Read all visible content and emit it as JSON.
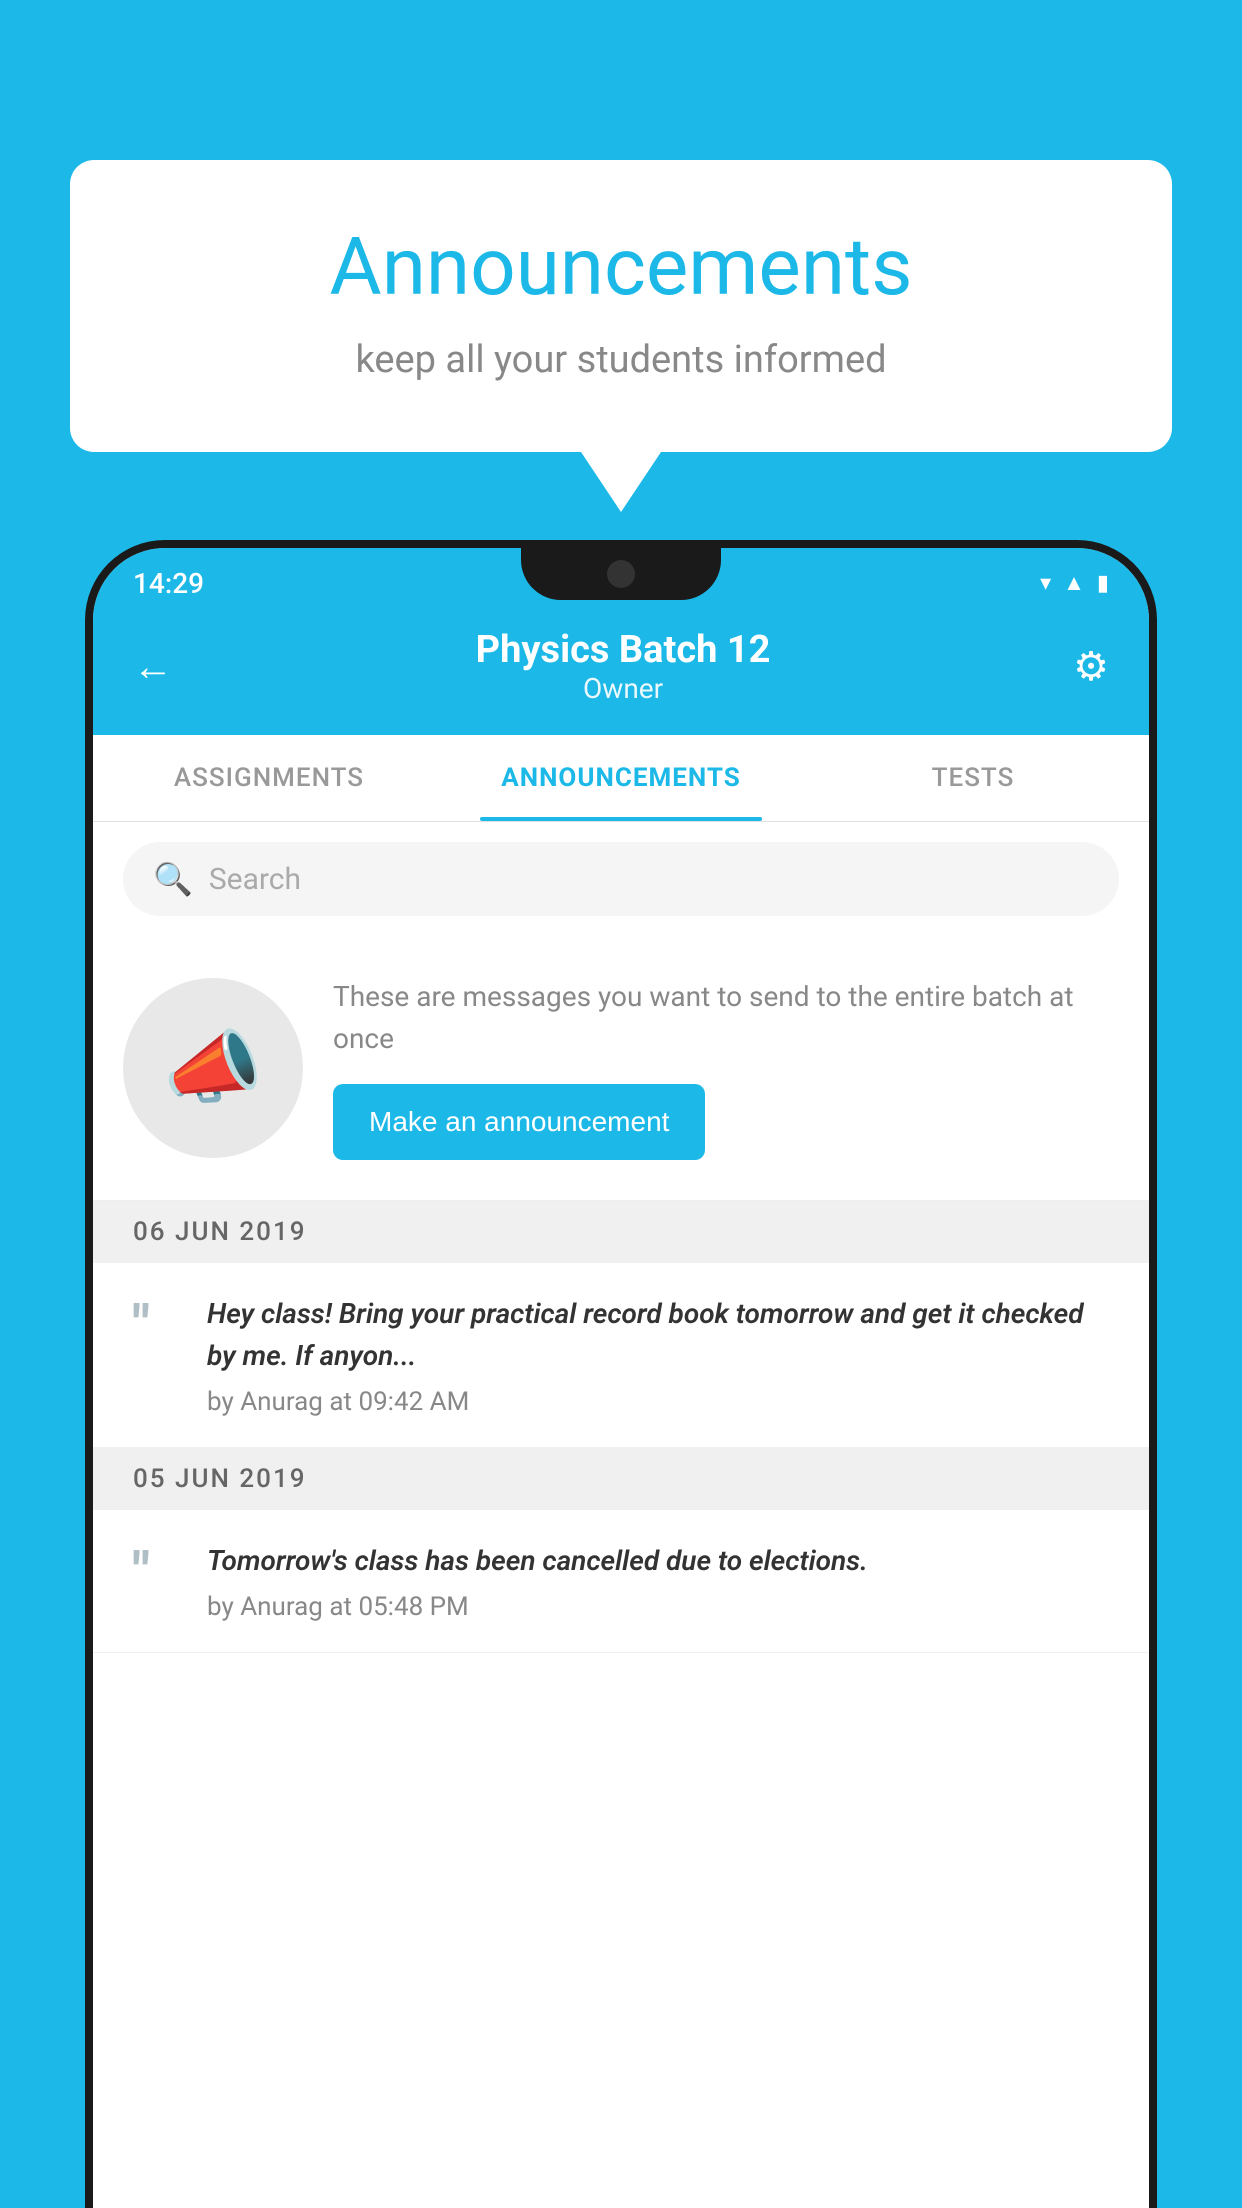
{
  "background_color": "#1BB8E8",
  "speech_bubble": {
    "title": "Announcements",
    "subtitle": "keep all your students informed"
  },
  "phone": {
    "status_bar": {
      "time": "14:29",
      "icons": [
        "wifi",
        "signal",
        "battery"
      ]
    },
    "header": {
      "title": "Physics Batch 12",
      "subtitle": "Owner",
      "back_label": "←",
      "gear_label": "⚙"
    },
    "tabs": [
      {
        "label": "ASSIGNMENTS",
        "active": false
      },
      {
        "label": "ANNOUNCEMENTS",
        "active": true
      },
      {
        "label": "TESTS",
        "active": false
      }
    ],
    "search": {
      "placeholder": "Search"
    },
    "promo": {
      "description": "These are messages you want to send to the entire batch at once",
      "button_label": "Make an announcement"
    },
    "announcements": [
      {
        "date": "06  JUN  2019",
        "text": "Hey class! Bring your practical record book tomorrow and get it checked by me. If anyon...",
        "meta": "by Anurag at 09:42 AM"
      },
      {
        "date": "05  JUN  2019",
        "text": "Tomorrow's class has been cancelled due to elections.",
        "meta": "by Anurag at 05:48 PM"
      }
    ]
  }
}
